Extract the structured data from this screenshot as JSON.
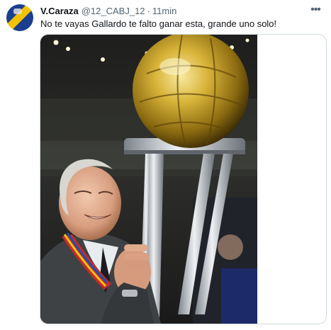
{
  "tweet": {
    "display_name": "V.Caraza",
    "handle": "@12_CABJ_12",
    "separator": "·",
    "time": "11min",
    "text": "No te vayas Gallardo te falto ganar esta, grande uno solo!",
    "more_icon": "more-horizontal-icon",
    "footer": "",
    "media_description": "photo of a man smiling holding a golden ball trophy"
  },
  "colors": {
    "text_primary": "#0f1419",
    "text_secondary": "#536471",
    "border": "#cfd9de",
    "avatar_blue": "#1b3f8f",
    "avatar_yellow": "#f2c200"
  }
}
